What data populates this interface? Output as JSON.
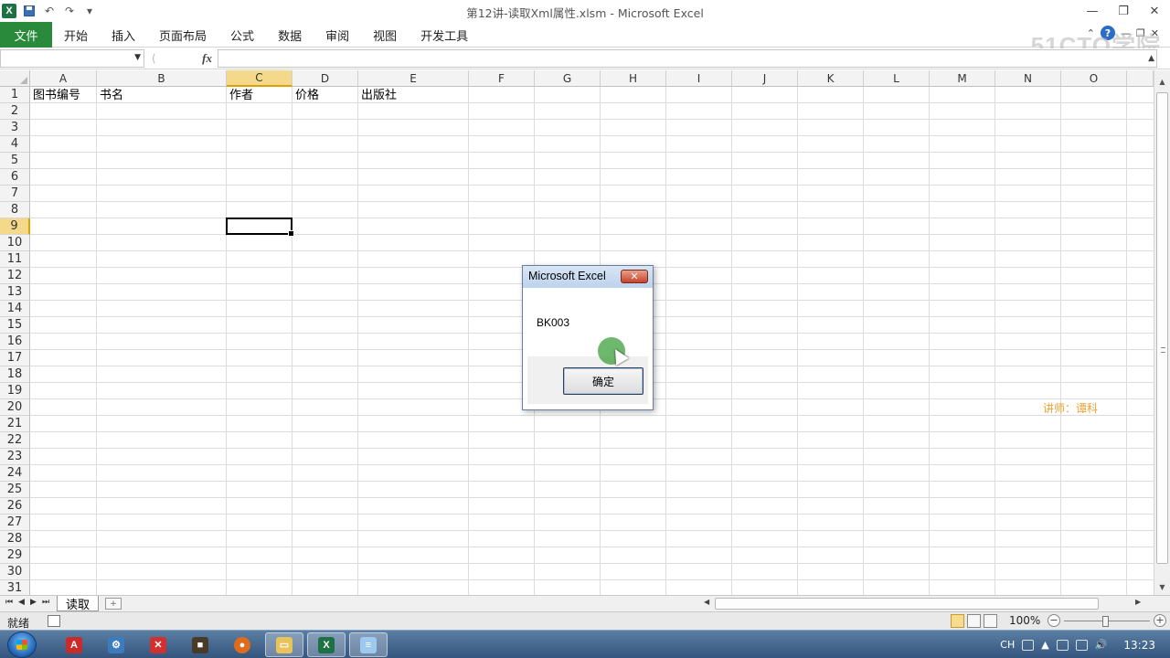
{
  "window": {
    "title": "第12讲-读取Xml属性.xlsm  -  Microsoft Excel",
    "app_icon_letter": "X"
  },
  "ribbon": {
    "file_tab": "文件",
    "tabs": [
      "开始",
      "插入",
      "页面布局",
      "公式",
      "数据",
      "审阅",
      "视图",
      "开发工具"
    ],
    "watermark": "51CTO学院"
  },
  "formula_bar": {
    "name_box_value": "",
    "fx_label": "fx",
    "formula_value": ""
  },
  "grid": {
    "columns": [
      "A",
      "B",
      "C",
      "D",
      "E",
      "F",
      "G",
      "H",
      "I",
      "J",
      "K",
      "L",
      "M",
      "N",
      "O"
    ],
    "active_column": "C",
    "rows": [
      "1",
      "2",
      "3",
      "4",
      "5",
      "6",
      "7",
      "8",
      "9",
      "10",
      "11",
      "12",
      "13",
      "14",
      "15",
      "16",
      "17",
      "18",
      "19",
      "20",
      "21",
      "22",
      "23",
      "24",
      "25",
      "26",
      "27",
      "28",
      "29",
      "30",
      "31"
    ],
    "active_row": "9",
    "row1_cells": {
      "A": "图书编号",
      "B": "书名",
      "C": "作者",
      "D": "价格",
      "E": "出版社"
    },
    "lecturer_note": "讲师：谭科"
  },
  "sheet_tabs": {
    "active": "读取"
  },
  "status_bar": {
    "status": "就绪",
    "zoom": "100%"
  },
  "dialog": {
    "title": "Microsoft Excel",
    "message": "BK003",
    "ok_label": "确定",
    "close_glyph": "✕"
  },
  "taskbar": {
    "lang": "CH",
    "clock": "13:23"
  },
  "colors": {
    "file_tab": "#2a8a3c",
    "active_header": "#f5d98b",
    "lecturer": "#f0a030"
  }
}
